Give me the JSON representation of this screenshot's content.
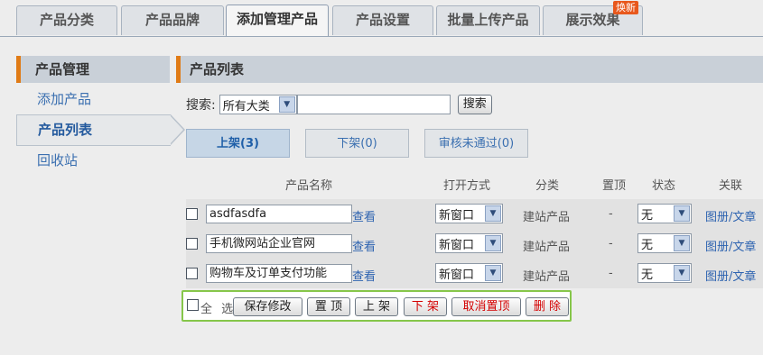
{
  "tabs": [
    {
      "label": "产品分类"
    },
    {
      "label": "产品品牌"
    },
    {
      "label": "添加管理产品"
    },
    {
      "label": "产品设置"
    },
    {
      "label": "批量上传产品"
    },
    {
      "label": "展示效果",
      "badge": "焕新"
    }
  ],
  "sidebar": {
    "title": "产品管理",
    "items": [
      {
        "label": "添加产品"
      },
      {
        "label": "产品列表"
      },
      {
        "label": "回收站"
      }
    ]
  },
  "main": {
    "title": "产品列表",
    "search": {
      "label": "搜索:",
      "category": "所有大类",
      "value": "",
      "button": "搜索"
    },
    "status_tabs": [
      {
        "label": "上架(3)"
      },
      {
        "label": "下架(0)"
      },
      {
        "label": "审核未通过(0)"
      }
    ],
    "columns": [
      "产品名称",
      "打开方式",
      "分类",
      "置顶",
      "状态",
      "关联"
    ],
    "rows": [
      {
        "name": "asdfasdfa",
        "view": "查看",
        "open": "新窗口",
        "category": "建站产品",
        "top": "-",
        "status": "无",
        "relate": "图册/文章"
      },
      {
        "name": "手机微网站企业官网",
        "view": "查看",
        "open": "新窗口",
        "category": "建站产品",
        "top": "-",
        "status": "无",
        "relate": "图册/文章"
      },
      {
        "name": "购物车及订单支付功能",
        "view": "查看",
        "open": "新窗口",
        "category": "建站产品",
        "top": "-",
        "status": "无",
        "relate": "图册/文章"
      }
    ],
    "actions": {
      "select_all": "全 选",
      "save": "保存修改",
      "pin": "置 顶",
      "list_on": "上 架",
      "list_off": "下 架",
      "unpin": "取消置顶",
      "delete": "删 除"
    }
  },
  "colors": {
    "accent": "#e07b16",
    "highlight_border": "#86c64a",
    "link": "#2d63b0",
    "danger": "#d40000"
  }
}
